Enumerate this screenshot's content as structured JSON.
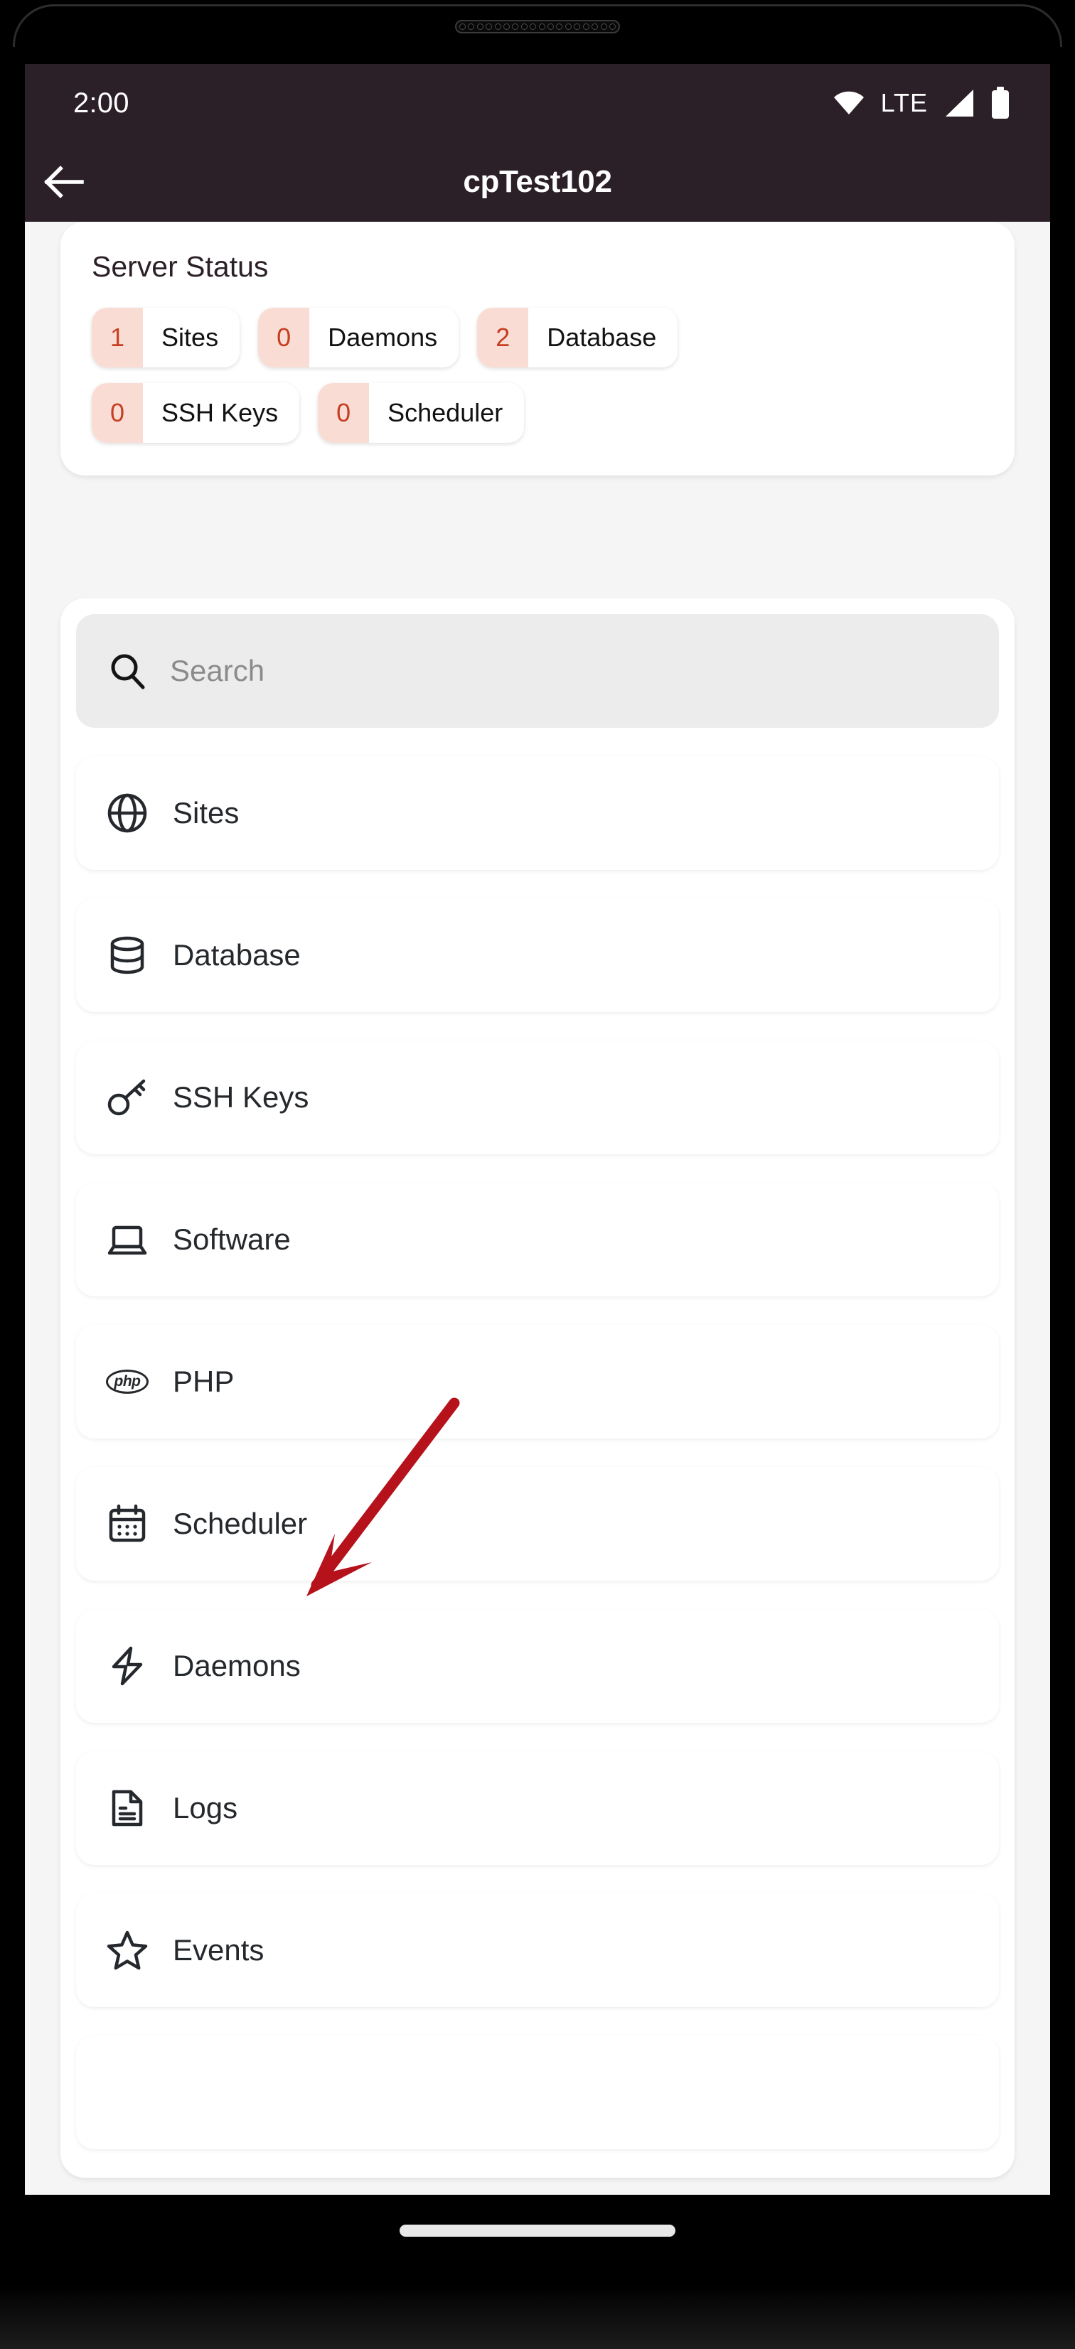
{
  "status_bar": {
    "time": "2:00",
    "network_label": "LTE",
    "icons": [
      "wifi-icon",
      "cellular-signal-icon",
      "battery-icon"
    ]
  },
  "app_bar": {
    "back_icon": "back-arrow-icon",
    "title": "cpTest102"
  },
  "server_status": {
    "title": "Server Status",
    "chips": [
      {
        "count": "1",
        "label": "Sites"
      },
      {
        "count": "0",
        "label": "Daemons"
      },
      {
        "count": "2",
        "label": "Database"
      },
      {
        "count": "0",
        "label": "SSH Keys"
      },
      {
        "count": "0",
        "label": "Scheduler"
      }
    ]
  },
  "search": {
    "icon": "search-icon",
    "placeholder": "Search",
    "value": ""
  },
  "menu": {
    "items": [
      {
        "label": "Sites",
        "icon": "globe-icon"
      },
      {
        "label": "Database",
        "icon": "database-icon"
      },
      {
        "label": "SSH Keys",
        "icon": "key-icon"
      },
      {
        "label": "Software",
        "icon": "laptop-icon"
      },
      {
        "label": "PHP",
        "icon": "php-icon",
        "icon_text": "php"
      },
      {
        "label": "Scheduler",
        "icon": "calendar-icon"
      },
      {
        "label": "Daemons",
        "icon": "lightning-bolt-icon"
      },
      {
        "label": "Logs",
        "icon": "document-icon"
      },
      {
        "label": "Events",
        "icon": "star-icon"
      }
    ]
  },
  "annotation": {
    "type": "arrow",
    "points_to": "PHP",
    "color": "#B5121B"
  },
  "colors": {
    "app_bar": "#2C2028",
    "page_background": "#F5F5F5",
    "card": "#FFFFFF",
    "chip_count_background": "#F9DDD4",
    "chip_count_text": "#C73F23",
    "search_background": "#ECECEC",
    "annotation_red": "#B5121B"
  }
}
